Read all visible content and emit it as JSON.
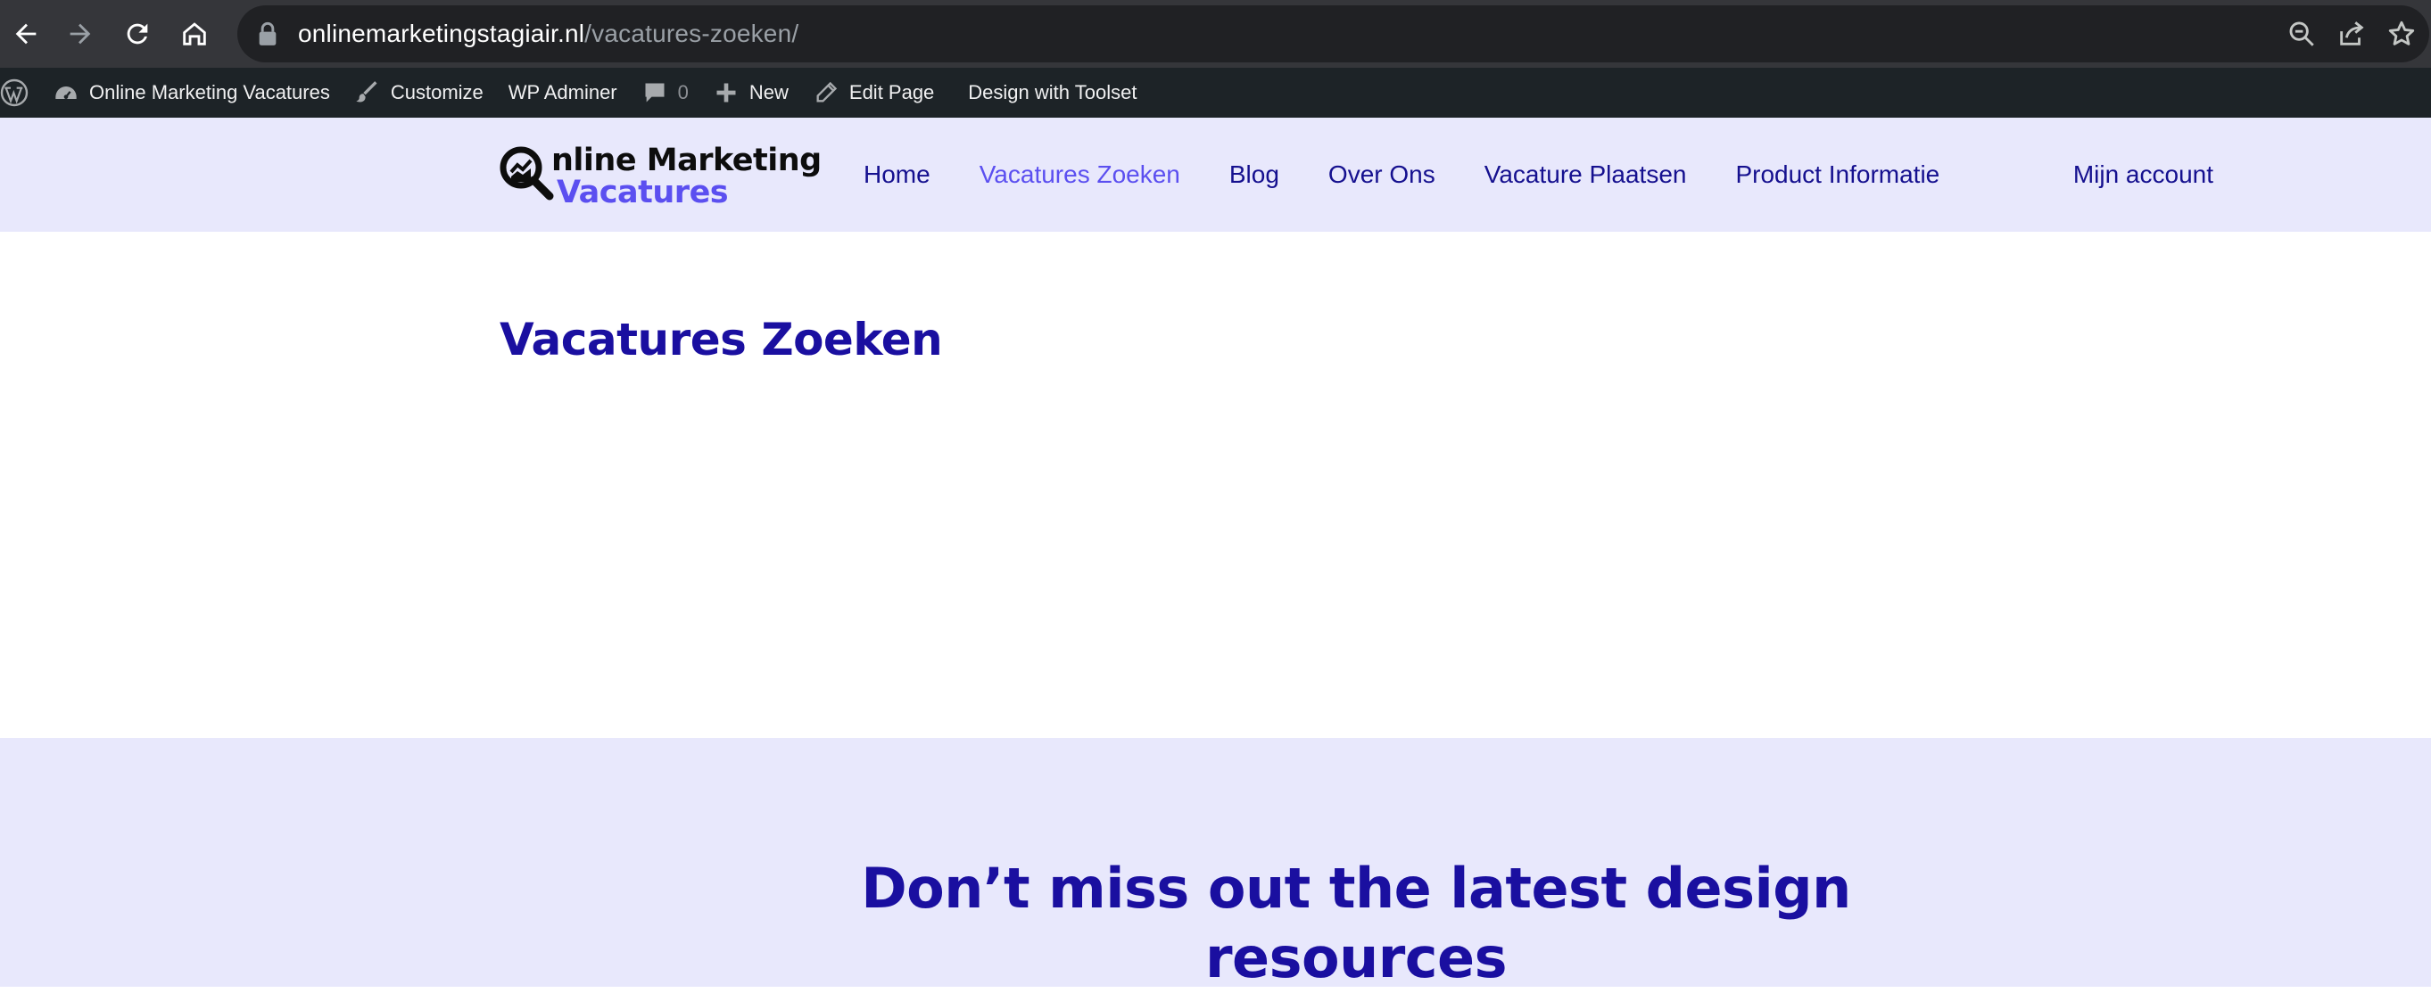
{
  "browser": {
    "url_host": "onlinemarketingstagiair.nl",
    "url_path": "/vacatures-zoeken/"
  },
  "wp_admin_bar": {
    "site_name": "Online Marketing Vacatures",
    "customize": "Customize",
    "wp_adminer": "WP Adminer",
    "comments_count": "0",
    "new": "New",
    "edit_page": "Edit Page",
    "design_with_toolset": "Design with Toolset"
  },
  "header": {
    "logo_line1": "nline Marketing",
    "logo_line2": "Vacatures",
    "nav": [
      {
        "label": "Home"
      },
      {
        "label": "Vacatures Zoeken"
      },
      {
        "label": "Blog"
      },
      {
        "label": "Over Ons"
      },
      {
        "label": "Vacature Plaatsen"
      },
      {
        "label": "Product Informatie"
      }
    ],
    "active_nav": "Vacatures Zoeken",
    "account": "Mijn account"
  },
  "main": {
    "title": "Vacatures Zoeken"
  },
  "newsletter": {
    "title": "Don’t miss out the latest design resources"
  },
  "colors": {
    "header_bg": "#e8e8fc",
    "brand_dark": "#1a0fa0",
    "brand_accent": "#5b4ff0",
    "wp_bar_bg": "#1d2327",
    "browser_bg": "#35363a"
  }
}
